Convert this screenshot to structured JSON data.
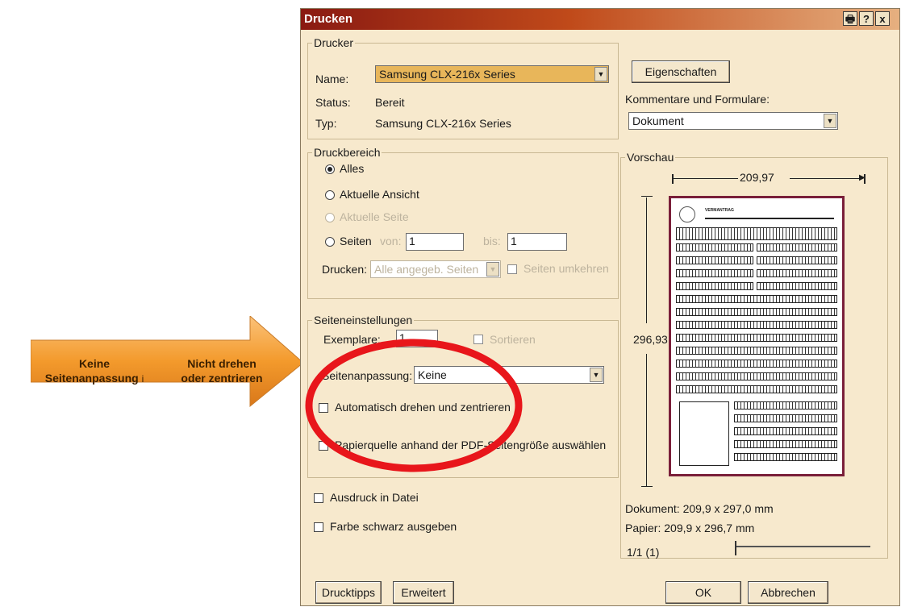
{
  "dialog": {
    "title": "Drucken",
    "help_button": "?",
    "close_button": "x"
  },
  "printer": {
    "group_label": "Drucker",
    "name_label": "Name:",
    "name_value": "Samsung CLX-216x Series",
    "status_label": "Status:",
    "status_value": "Bereit",
    "type_label": "Typ:",
    "type_value": "Samsung CLX-216x Series",
    "properties_button": "Eigenschaften",
    "comments_label": "Kommentare und Formulare:",
    "comments_value": "Dokument"
  },
  "print_range": {
    "group_label": "Druckbereich",
    "all": "Alles",
    "current_view": "Aktuelle Ansicht",
    "current_page": "Aktuelle Seite",
    "pages": "Seiten",
    "from_label": "von:",
    "from_value": "1",
    "to_label": "bis:",
    "to_value": "1",
    "print_label": "Drucken:",
    "print_value": "Alle angegeb. Seiten",
    "reverse_label": "Seiten umkehren"
  },
  "page_settings": {
    "group_label": "Seiteneinstellungen",
    "copies_label": "Exemplare:",
    "copies_value": "1",
    "collate_label": "Sortieren",
    "scaling_label": "Seitenanpassung:",
    "scaling_value": "Keine",
    "auto_rotate_label": "Automatisch drehen und zentrieren",
    "paper_source_label": "Papierquelle anhand der PDF-Seitengröße auswählen"
  },
  "options": {
    "print_to_file": "Ausdruck in Datei",
    "print_black": "Farbe schwarz ausgeben"
  },
  "preview": {
    "group_label": "Vorschau",
    "width": "209,97",
    "height": "296,93",
    "form_title": "VERMANTRAG",
    "document_size": "Dokument: 209,9 x 297,0 mm",
    "paper_size": "Papier: 209,9 x 296,7 mm",
    "page_counter": "1/1 (1)",
    "slider_position": 0
  },
  "footer": {
    "tips_button": "Drucktipps",
    "advanced_button": "Erweitert",
    "ok_button": "OK",
    "cancel_button": "Abbrechen"
  },
  "annotation": {
    "left_text_1": "Keine",
    "left_text_2": "Seitenanpassung",
    "left_text_3": "i",
    "right_text_1": "Nicht drehen",
    "right_text_2": "oder zentrieren",
    "arrow_color": "#f39a2c",
    "ellipse_color": "#e8161b"
  }
}
